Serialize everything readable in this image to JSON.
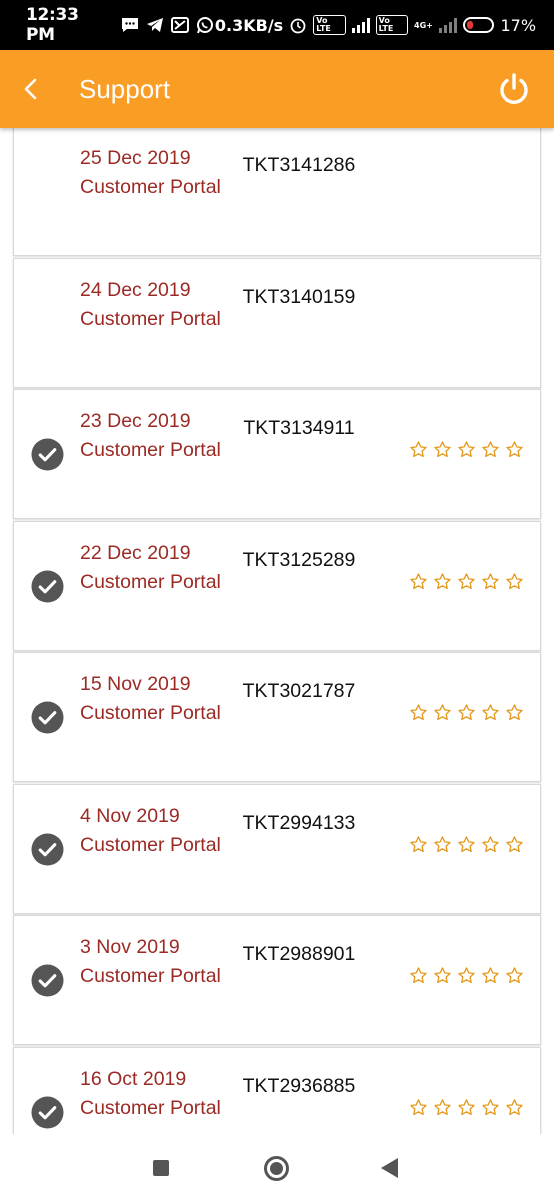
{
  "status": {
    "time": "12:33 PM",
    "speed": "0.3KB/s",
    "battery": "17%",
    "volte1": "Vo LTE",
    "volte2": "Vo LTE",
    "net": "4G+"
  },
  "appbar": {
    "title": "Support",
    "back_icon": "chevron-left-icon",
    "power_icon": "power-icon"
  },
  "colors": {
    "accent": "#f99d25",
    "date_text": "#9c2a24",
    "star": "#e39a1f",
    "check": "#555555"
  },
  "tickets": [
    {
      "date": "25 Dec 2019",
      "source": "Customer Portal",
      "id": "TKT3141286",
      "resolved": false
    },
    {
      "date": "24 Dec 2019",
      "source": "Customer Portal",
      "id": "TKT3140159",
      "resolved": false
    },
    {
      "date": "23 Dec 2019",
      "source": "Customer Portal",
      "id": "TKT3134911",
      "resolved": true
    },
    {
      "date": "22 Dec 2019",
      "source": "Customer Portal",
      "id": "TKT3125289",
      "resolved": true
    },
    {
      "date": "15 Nov 2019",
      "source": "Customer Portal",
      "id": "TKT3021787",
      "resolved": true
    },
    {
      "date": "4 Nov 2019",
      "source": "Customer Portal",
      "id": "TKT2994133",
      "resolved": true
    },
    {
      "date": "3 Nov 2019",
      "source": "Customer Portal",
      "id": "TKT2988901",
      "resolved": true
    },
    {
      "date": "16 Oct 2019",
      "source": "Customer Portal",
      "id": "TKT2936885",
      "resolved": true
    }
  ]
}
